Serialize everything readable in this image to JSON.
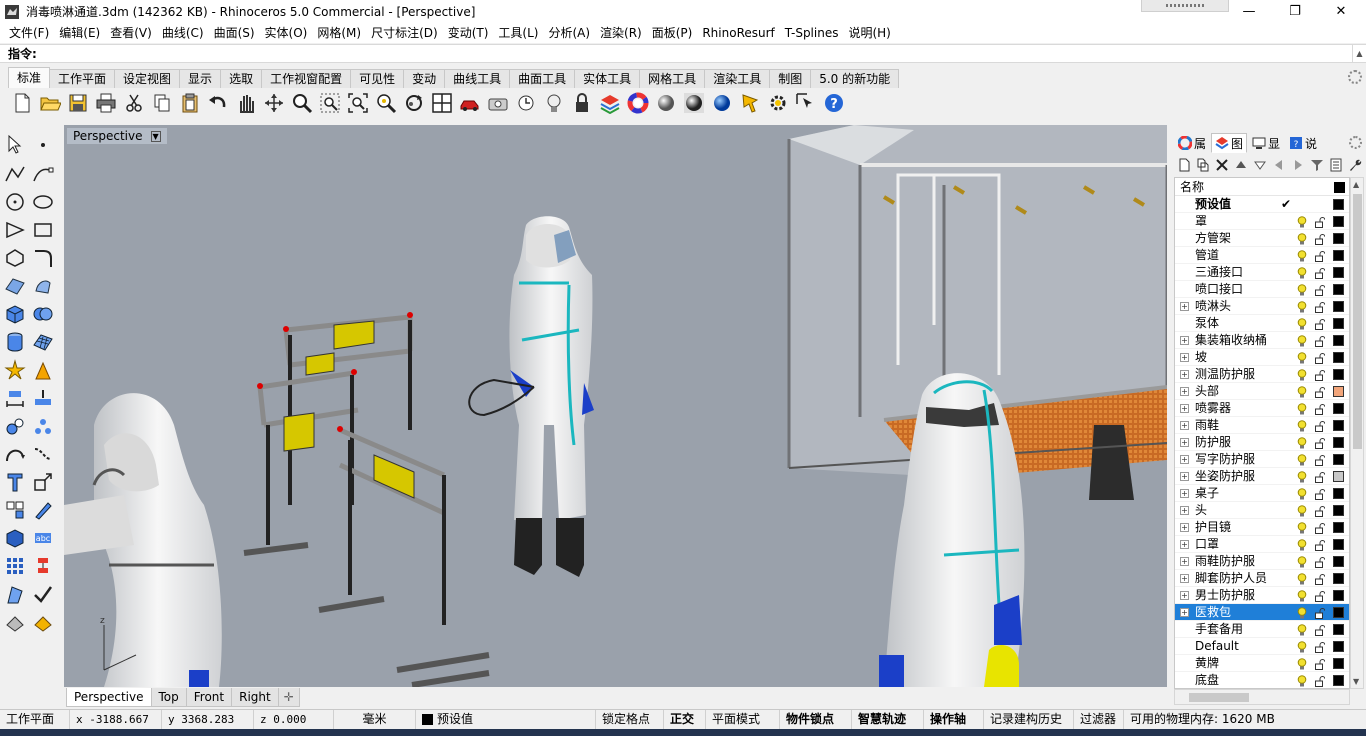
{
  "window": {
    "title": "消毒喷淋通道.3dm (142362 KB) - Rhinoceros 5.0 Commercial - [Perspective]",
    "minimize": "—",
    "restore": "❐",
    "close": "✕"
  },
  "menu": [
    "文件(F)",
    "编辑(E)",
    "查看(V)",
    "曲线(C)",
    "曲面(S)",
    "实体(O)",
    "网格(M)",
    "尺寸标注(D)",
    "变动(T)",
    "工具(L)",
    "分析(A)",
    "渲染(R)",
    "面板(P)",
    "RhinoResurf",
    "T-Splines",
    "说明(H)"
  ],
  "command": {
    "label": "指令:",
    "value": ""
  },
  "toolbar_tabs": [
    "标准",
    "工作平面",
    "设定视图",
    "显示",
    "选取",
    "工作视窗配置",
    "可见性",
    "变动",
    "曲线工具",
    "曲面工具",
    "实体工具",
    "网格工具",
    "渲染工具",
    "制图",
    "5.0 的新功能"
  ],
  "toolbar_active_tab": "标准",
  "toolbar_icons": [
    "new-file-icon",
    "open-folder-icon",
    "save-icon",
    "print-icon",
    "cut-icon",
    "copy-icon",
    "paste-icon",
    "undo-icon",
    "pan-hand-icon",
    "rotate-view-icon",
    "zoom-icon",
    "zoom-window-icon",
    "zoom-extents-icon",
    "zoom-selected-icon",
    "rotate-icon",
    "viewport-layout-icon",
    "car-icon",
    "camera-icon",
    "named-view-icon",
    "lightbulb-icon",
    "lock-icon",
    "layer-color-icon",
    "color-wheel-icon",
    "shaded-sphere-icon",
    "rendered-sphere-icon",
    "blue-sphere-icon",
    "options-icon",
    "gear-settings-icon",
    "cursor-icon",
    "help-icon"
  ],
  "viewport": {
    "title": "Perspective",
    "tabs": [
      "Perspective",
      "Top",
      "Front",
      "Right"
    ],
    "active_tab": "Perspective",
    "bg_color": "#9aa1ab"
  },
  "panel": {
    "tabs": [
      {
        "icon": "properties-icon",
        "label": "属"
      },
      {
        "icon": "layers-icon",
        "label": "图"
      },
      {
        "icon": "display-icon",
        "label": "显"
      },
      {
        "icon": "help-panel-icon",
        "label": "说"
      }
    ],
    "active_tab": "图",
    "column_header": "名称",
    "layers": [
      {
        "name": "预设值",
        "expandable": false,
        "current": true,
        "bold": true,
        "color": "#000000"
      },
      {
        "name": "罩",
        "expandable": false,
        "color": "#000000"
      },
      {
        "name": "方管架",
        "expandable": false,
        "color": "#000000"
      },
      {
        "name": "管道",
        "expandable": false,
        "color": "#000000"
      },
      {
        "name": "三通接口",
        "expandable": false,
        "color": "#000000"
      },
      {
        "name": "喷口接口",
        "expandable": false,
        "color": "#000000"
      },
      {
        "name": "喷淋头",
        "expandable": true,
        "color": "#000000"
      },
      {
        "name": "泵体",
        "expandable": false,
        "color": "#000000"
      },
      {
        "name": "集装箱收纳桶",
        "expandable": true,
        "color": "#000000"
      },
      {
        "name": "坡",
        "expandable": true,
        "color": "#000000"
      },
      {
        "name": "测温防护服",
        "expandable": true,
        "color": "#000000"
      },
      {
        "name": "头部",
        "expandable": true,
        "color": "#f2a57a"
      },
      {
        "name": "喷雾器",
        "expandable": true,
        "color": "#000000"
      },
      {
        "name": "雨鞋",
        "expandable": true,
        "color": "#000000"
      },
      {
        "name": "防护服",
        "expandable": true,
        "color": "#000000"
      },
      {
        "name": "写字防护服",
        "expandable": true,
        "color": "#000000"
      },
      {
        "name": "坐姿防护服",
        "expandable": true,
        "color": "#c8c8c8"
      },
      {
        "name": "桌子",
        "expandable": true,
        "color": "#000000"
      },
      {
        "name": "头",
        "expandable": true,
        "color": "#000000"
      },
      {
        "name": "护目镜",
        "expandable": true,
        "color": "#000000"
      },
      {
        "name": "口罩",
        "expandable": true,
        "color": "#000000"
      },
      {
        "name": "雨鞋防护服",
        "expandable": true,
        "color": "#000000"
      },
      {
        "name": "脚套防护人员",
        "expandable": true,
        "color": "#000000"
      },
      {
        "name": "男士防护服",
        "expandable": true,
        "color": "#000000"
      },
      {
        "name": "医救包",
        "expandable": true,
        "selected": true,
        "color": "#000000"
      },
      {
        "name": "手套备用",
        "expandable": false,
        "color": "#000000"
      },
      {
        "name": "Default",
        "expandable": false,
        "color": "#000000"
      },
      {
        "name": "黄牌",
        "expandable": false,
        "color": "#000000"
      },
      {
        "name": "底盘",
        "expandable": false,
        "color": "#000000"
      }
    ]
  },
  "status": {
    "cplane": "工作平面",
    "x": "x -3188.667",
    "y": "y 3368.283",
    "z": "z 0.000",
    "units": "毫米",
    "layer": "预设值",
    "grid_snap": "锁定格点",
    "ortho": "正交",
    "planar": "平面模式",
    "osnap": "物件锁点",
    "smarttrack": "智慧轨迹",
    "gumball": "操作轴",
    "history": "记录建构历史",
    "filter": "过滤器",
    "memory": "可用的物理内存: 1620 MB"
  }
}
